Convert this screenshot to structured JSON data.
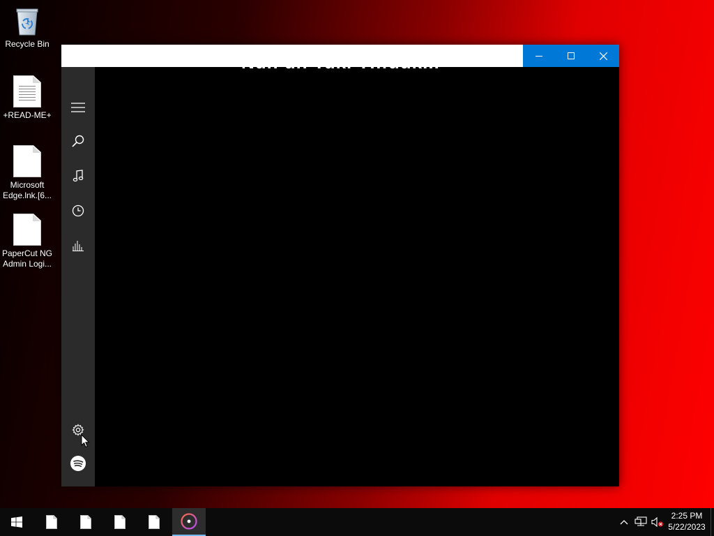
{
  "desktop": {
    "icons": [
      {
        "label": "Recycle Bin",
        "icon": "recycle-bin-icon"
      },
      {
        "label": "+READ-ME+",
        "icon": "text-document-icon"
      },
      {
        "label": "Microsoft Edge.lnk.[6...",
        "icon": "blank-file-icon"
      },
      {
        "label": "PaperCut NG Admin Logi...",
        "icon": "blank-file-icon"
      }
    ]
  },
  "window": {
    "title": "",
    "controls": {
      "minimize": "minimize-icon",
      "maximize": "maximize-icon",
      "close": "close-icon"
    },
    "accent_color": "#0078d7"
  },
  "nav": {
    "items": [
      {
        "name": "menu",
        "icon": "hamburger-menu-icon"
      },
      {
        "name": "search",
        "icon": "search-icon"
      },
      {
        "name": "music",
        "icon": "music-note-icon"
      },
      {
        "name": "recent",
        "icon": "clock-icon"
      },
      {
        "name": "stats",
        "icon": "bar-chart-icon"
      },
      {
        "name": "settings",
        "icon": "gear-icon"
      },
      {
        "name": "spotify",
        "icon": "spotify-icon"
      }
    ]
  },
  "content": {
    "partial_heading": "Nuh uh Tukl Thfuuk..."
  },
  "taskbar": {
    "start_icon": "windows-start-icon",
    "pinned": [
      {
        "name": "file-1",
        "icon": "file-icon"
      },
      {
        "name": "file-2",
        "icon": "file-icon"
      },
      {
        "name": "file-3",
        "icon": "file-icon"
      },
      {
        "name": "file-4",
        "icon": "file-icon"
      },
      {
        "name": "music-app",
        "icon": "music-disc-icon",
        "active": true
      }
    ],
    "tray": {
      "icons": [
        "chevron-up-icon",
        "network-icon",
        "volume-muted-icon"
      ],
      "time": "2:25 PM",
      "date": "5/22/2023"
    }
  }
}
